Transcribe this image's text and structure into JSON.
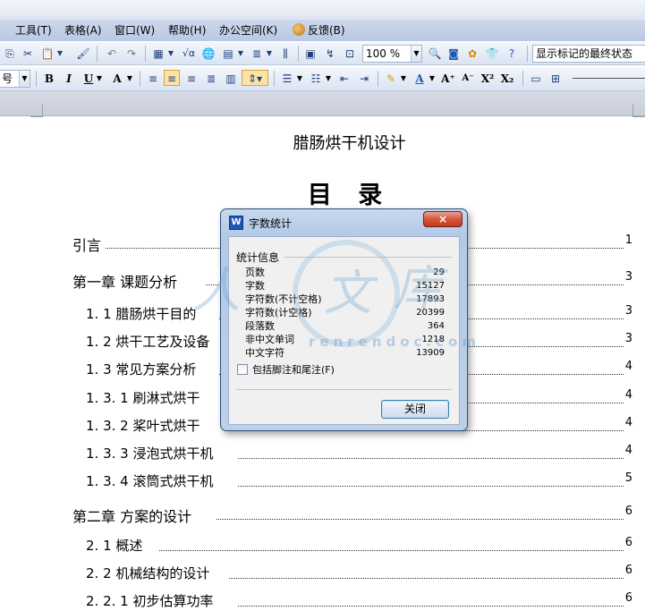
{
  "menu": {
    "items": [
      {
        "label": "工具(T)"
      },
      {
        "label": "表格(A)"
      },
      {
        "label": "窗口(W)"
      },
      {
        "label": "帮助(H)"
      },
      {
        "label": "办公空间(K)"
      },
      {
        "label": "反馈(B)"
      }
    ]
  },
  "toolbar": {
    "zoom_value": "100 %",
    "sqrt_label": "√α",
    "track_changes_value": "显示标记的最终状态"
  },
  "format_toolbar": {
    "bold": "B",
    "italic": "I",
    "underline": "U",
    "superscript": "X²",
    "subscript": "X₂",
    "font_color_label": "A"
  },
  "document": {
    "title": "腊肠烘干机设计",
    "toc_heading": "目 录",
    "toc": [
      {
        "text": "引言",
        "page": "1",
        "level": 1
      },
      {
        "text": "第一章  课题分析",
        "page": "3",
        "level": 1
      },
      {
        "text": "1. 1  腊肠烘干目的",
        "page": "3",
        "level": 2
      },
      {
        "text": "1. 2  烘干工艺及设备",
        "page": "3",
        "level": 2
      },
      {
        "text": "1. 3  常见方案分析",
        "page": "4",
        "level": 2
      },
      {
        "text": "1. 3. 1  刷淋式烘干",
        "page": "4",
        "level": 3
      },
      {
        "text": "1. 3. 2  桨叶式烘干",
        "page": "4",
        "level": 3
      },
      {
        "text": "1. 3. 3  浸泡式烘干机",
        "page": "4",
        "level": 3
      },
      {
        "text": "1. 3. 4  滚筒式烘干机",
        "page": "5",
        "level": 3
      },
      {
        "text": "第二章  方案的设计",
        "page": "6",
        "level": 1
      },
      {
        "text": "2. 1  概述",
        "page": "6",
        "level": 2
      },
      {
        "text": "2. 2  机械结构的设计",
        "page": "6",
        "level": 2
      },
      {
        "text": "2. 2. 1  初步估算功率",
        "page": "6",
        "level": 3
      }
    ]
  },
  "watermark": {
    "text": "人人文库",
    "url": "renrendoc.com"
  },
  "dialog": {
    "icon_label": "W",
    "title": "字数统计",
    "group_label": "统计信息",
    "stats": [
      {
        "label": "页数",
        "value": "29"
      },
      {
        "label": "字数",
        "value": "15127"
      },
      {
        "label": "字符数(不计空格)",
        "value": "17893"
      },
      {
        "label": "字符数(计空格)",
        "value": "20399"
      },
      {
        "label": "段落数",
        "value": "364"
      },
      {
        "label": "非中文单词",
        "value": "1218"
      },
      {
        "label": "中文字符",
        "value": "13909"
      }
    ],
    "include_footnotes_label": "包括脚注和尾注(F)",
    "close_button": "关闭",
    "titlebar_close": "×"
  }
}
